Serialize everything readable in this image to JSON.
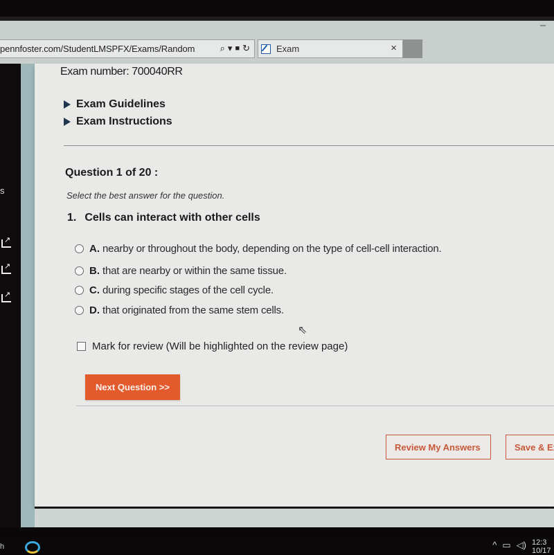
{
  "browser": {
    "url": "pennfoster.com/StudentLMSPFX/Exams/Random",
    "tab_title": "Exam",
    "tab_close": "×",
    "icons": {
      "search": "⌕",
      "dropdown": "▾",
      "lock": "🔒",
      "refresh": "↻"
    }
  },
  "page": {
    "exam_number": "Exam number: 700040RR",
    "sections": [
      {
        "label": "Exam Guidelines"
      },
      {
        "label": "Exam Instructions"
      }
    ],
    "question": {
      "header": "Question 1 of 20 :",
      "instruction": "Select the best answer for the question.",
      "number": "1.",
      "text": "Cells can interact with other cells",
      "options": [
        {
          "letter": "A.",
          "text": "nearby or throughout the body, depending on the type of cell-cell interaction.",
          "selected": false
        },
        {
          "letter": "B.",
          "text": "that are nearby or within the same tissue.",
          "selected": false
        },
        {
          "letter": "C.",
          "text": "during specific stages of the cell cycle.",
          "selected": false
        },
        {
          "letter": "D.",
          "text": "that originated from the same stem cells.",
          "selected": false
        }
      ]
    },
    "mark_review": {
      "label": "Mark for review (Will be highlighted on the review page)",
      "checked": false
    },
    "buttons": {
      "next": "Next Question >>",
      "review": "Review My Answers",
      "save": "Save & Exit"
    },
    "colors": {
      "accent": "#e35a2c",
      "outline_accent": "#c9583a"
    }
  },
  "taskbar": {
    "clock_time": "12:3",
    "clock_date": "10/17",
    "tray_icons": {
      "chevron": "^",
      "network": "▭",
      "volume": "🔊"
    }
  }
}
